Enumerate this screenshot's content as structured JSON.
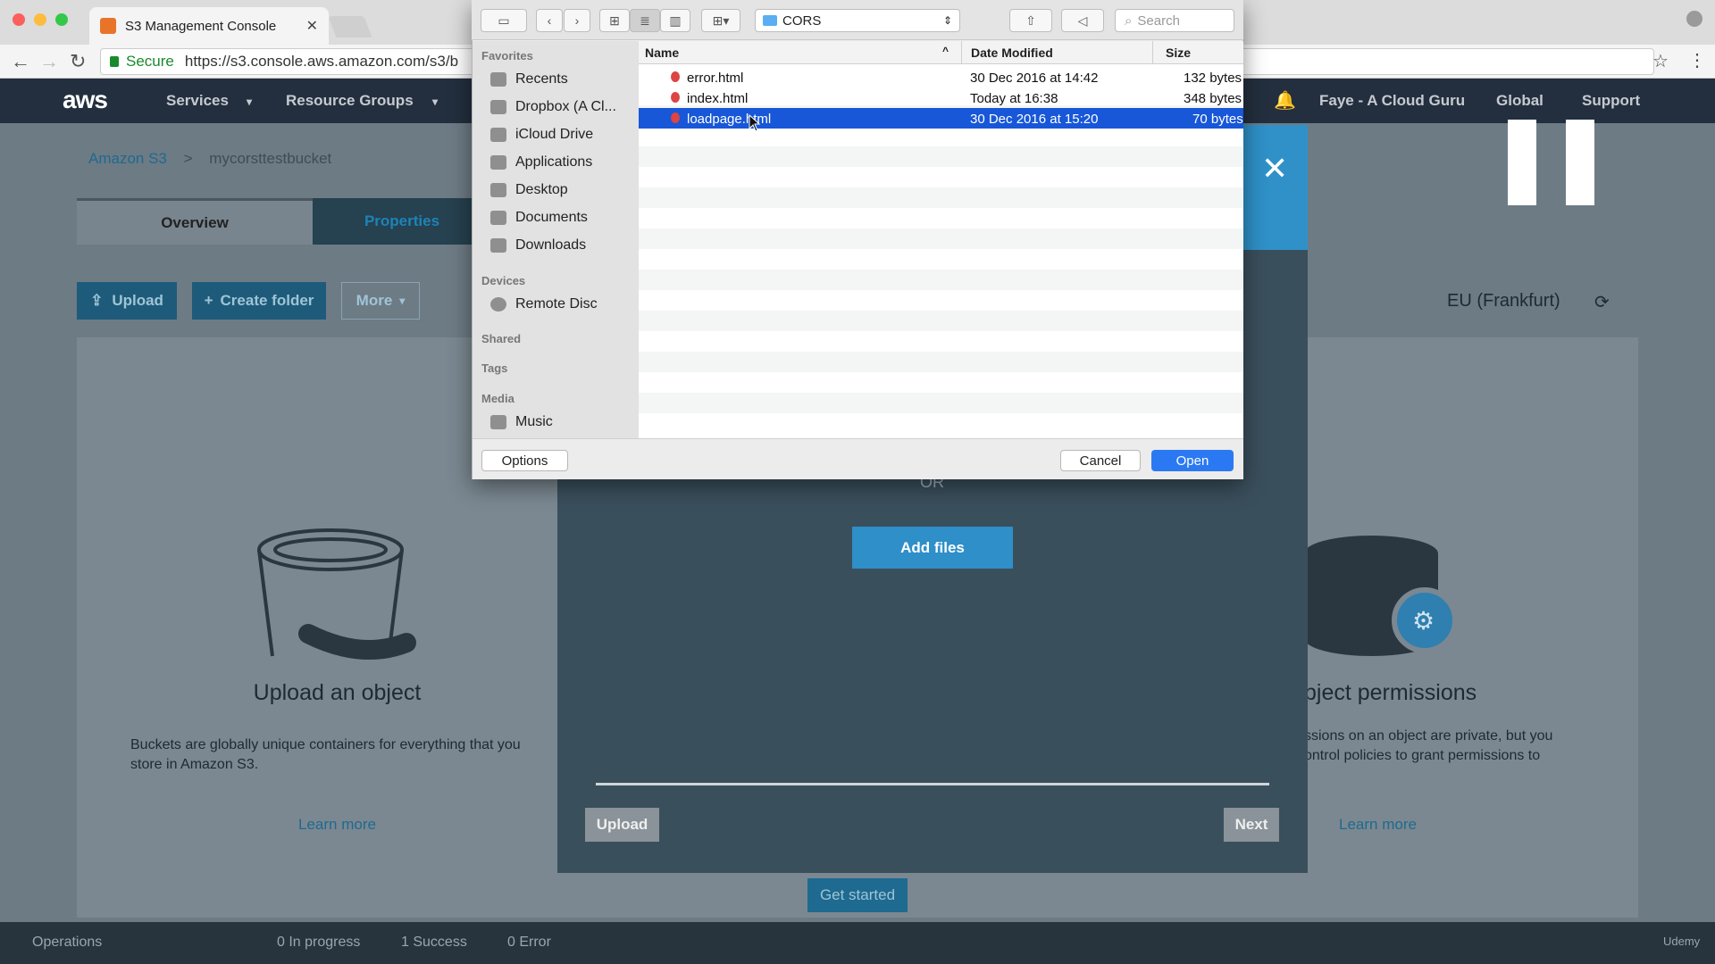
{
  "browser": {
    "tab_title": "S3 Management Console",
    "secure_label": "Secure",
    "url": "https://s3.console.aws.amazon.com/s3/b"
  },
  "aws_nav": {
    "logo": "aws",
    "services": "Services",
    "resource_groups": "Resource Groups",
    "user": "Faye - A Cloud Guru",
    "region_menu": "Global",
    "support": "Support"
  },
  "breadcrumb": {
    "root": "Amazon S3",
    "separator": ">",
    "bucket": "mycorsttestbucket"
  },
  "tabs": {
    "overview": "Overview",
    "properties": "Properties"
  },
  "actions": {
    "upload": "Upload",
    "create_folder": "Create folder",
    "more": "More"
  },
  "region": "EU (Frankfurt)",
  "cards": {
    "upload_title": "Upload an object",
    "upload_desc": "Buckets are globally unique containers for everything that you store in Amazon S3.",
    "learn_more": "Learn more",
    "perm_title": "bject permissions",
    "perm_desc": "ssions on an object are private, but you ontrol policies to grant permissions to",
    "learn_more_2": "Learn more",
    "get_started": "Get started"
  },
  "modal": {
    "or": "OR",
    "add_files": "Add files",
    "upload": "Upload",
    "next": "Next"
  },
  "status": {
    "operations": "Operations",
    "in_progress": "0 In progress",
    "success": "1 Success",
    "error": "0 Error",
    "brand": "Udemy"
  },
  "dialog": {
    "folder": "CORS",
    "search_placeholder": "Search",
    "favorites_header": "Favorites",
    "favorites": [
      "Recents",
      "Dropbox (A Cl...",
      "iCloud Drive",
      "Applications",
      "Desktop",
      "Documents",
      "Downloads"
    ],
    "devices_header": "Devices",
    "devices": [
      "Remote Disc"
    ],
    "shared_header": "Shared",
    "tags_header": "Tags",
    "media_header": "Media",
    "media": [
      "Music"
    ],
    "columns": {
      "name": "Name",
      "date": "Date Modified",
      "size": "Size"
    },
    "files": [
      {
        "name": "error.html",
        "date": "30 Dec 2016 at 14:42",
        "size": "132 bytes"
      },
      {
        "name": "index.html",
        "date": "Today at 16:38",
        "size": "348 bytes"
      },
      {
        "name": "loadpage.html",
        "date": "30 Dec 2016 at 15:20",
        "size": "70 bytes"
      }
    ],
    "options": "Options",
    "cancel": "Cancel",
    "open": "Open"
  }
}
